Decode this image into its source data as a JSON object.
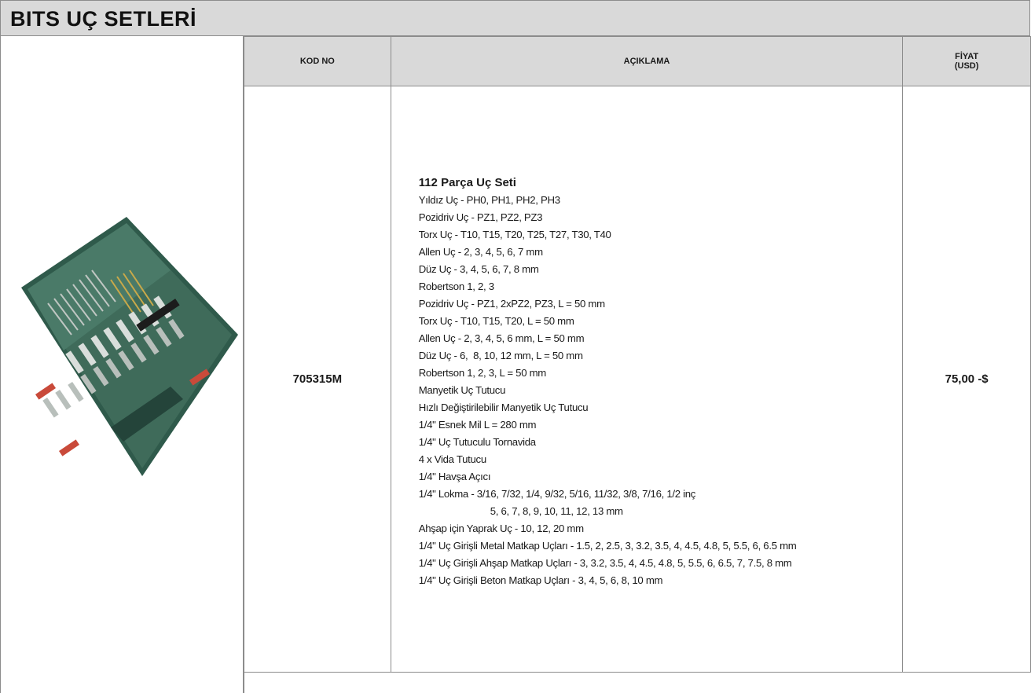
{
  "page": {
    "title": "BITS UÇ SETLERİ"
  },
  "table": {
    "headers": {
      "kod": "KOD NO",
      "aciklama": "AÇIKLAMA",
      "fiyat_line1": "FİYAT",
      "fiyat_line2": "(USD)"
    },
    "row": {
      "kod": "705315M",
      "price": "75,00 -$",
      "description_title": "112 Parça Uç Seti",
      "description_lines": [
        "Yıldız Uç - PH0, PH1, PH2, PH3",
        "Pozidriv Uç - PZ1, PZ2, PZ3",
        "Torx Uç - T10, T15, T20, T25, T27, T30, T40",
        "Allen Uç - 2, 3, 4, 5, 6, 7 mm",
        "Düz Uç - 3, 4, 5, 6, 7, 8 mm",
        "Robertson 1, 2, 3",
        "Pozidriv Uç - PZ1, 2xPZ2, PZ3, L = 50 mm",
        "Torx Uç - T10, T15, T20, L = 50 mm",
        "Allen Uç - 2, 3, 4, 5, 6 mm, L = 50 mm",
        "Düz Uç - 6,  8, 10, 12 mm, L = 50 mm",
        "Robertson 1, 2, 3, L = 50 mm",
        "Manyetik Uç Tutucu",
        "Hızlı Değiştirilebilir Manyetik Uç Tutucu",
        "1/4\" Esnek Mil L = 280 mm",
        "1/4\" Uç Tutuculu Tornavida",
        "4 x Vida Tutucu",
        "1/4\" Havşa Açıcı",
        "1/4\" Lokma - 3/16, 7/32, 1/4, 9/32, 5/16, 11/32, 3/8, 7/16, 1/2 inç",
        "5, 6, 7, 8, 9, 10, 11, 12, 13 mm",
        "Ahşap için Yaprak Uç - 10, 12, 20 mm",
        "1/4\" Uç Girişli Metal Matkap Uçları - 1.5, 2, 2.5, 3, 3.2, 3.5, 4, 4.5, 4.8, 5, 5.5, 6, 6.5 mm",
        "1/4\" Uç Girişli Ahşap Matkap Uçları - 3, 3.2, 3.5, 4, 4.5, 4.8, 5, 5.5, 6, 6.5, 7, 7.5, 8 mm",
        "1/4\" Uç Girişli Beton Matkap Uçları - 3, 4, 5, 6, 8, 10 mm"
      ]
    }
  },
  "product_image": {
    "icon": "bit-set-case-icon",
    "case_color": "#3f6b5a"
  }
}
